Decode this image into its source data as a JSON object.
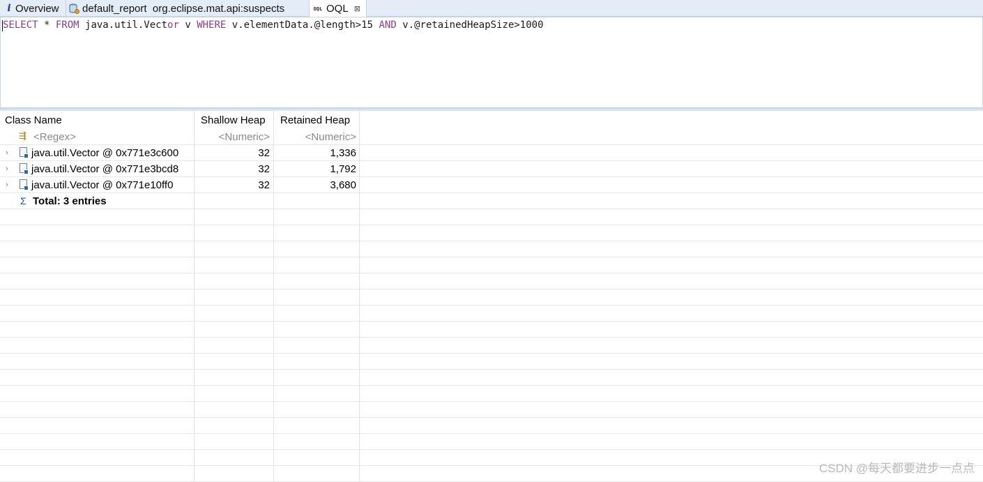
{
  "tabs": [
    {
      "label": "Overview",
      "icon": "info-icon"
    },
    {
      "label": "default_report  org.eclipse.mat.api:suspects",
      "icon": "database-report-icon"
    },
    {
      "label": "OQL",
      "icon": "oql-icon",
      "close": "⊠"
    }
  ],
  "oql_icon_text": "OQL",
  "query": {
    "parts": [
      {
        "t": "SELECT",
        "kw": true
      },
      {
        "t": " * ",
        "kw": false
      },
      {
        "t": "FROM",
        "kw": true
      },
      {
        "t": " java.util.Vect",
        "kw": false
      },
      {
        "t": "or",
        "kw": true
      },
      {
        "t": " v ",
        "kw": false
      },
      {
        "t": "WHERE",
        "kw": true
      },
      {
        "t": " v.elementData.@length>15 ",
        "kw": false
      },
      {
        "t": "AND",
        "kw": true
      },
      {
        "t": " v.@retainedHeapSize>1000",
        "kw": false
      }
    ]
  },
  "table": {
    "headers": [
      "Class Name",
      "Shallow Heap",
      "Retained Heap"
    ],
    "filters": [
      "<Regex>",
      "<Numeric>",
      "<Numeric>"
    ],
    "rows": [
      {
        "name": "java.util.Vector @ 0x771e3c600",
        "shallow": "32",
        "retained": "1,336"
      },
      {
        "name": "java.util.Vector @ 0x771e3bcd8",
        "shallow": "32",
        "retained": "1,792"
      },
      {
        "name": "java.util.Vector @ 0x771e10ff0",
        "shallow": "32",
        "retained": "3,680"
      }
    ],
    "total": "Total: 3 entries",
    "sigma": "Σ",
    "expander": "›"
  },
  "watermark": "CSDN @每天都要进步一点点"
}
